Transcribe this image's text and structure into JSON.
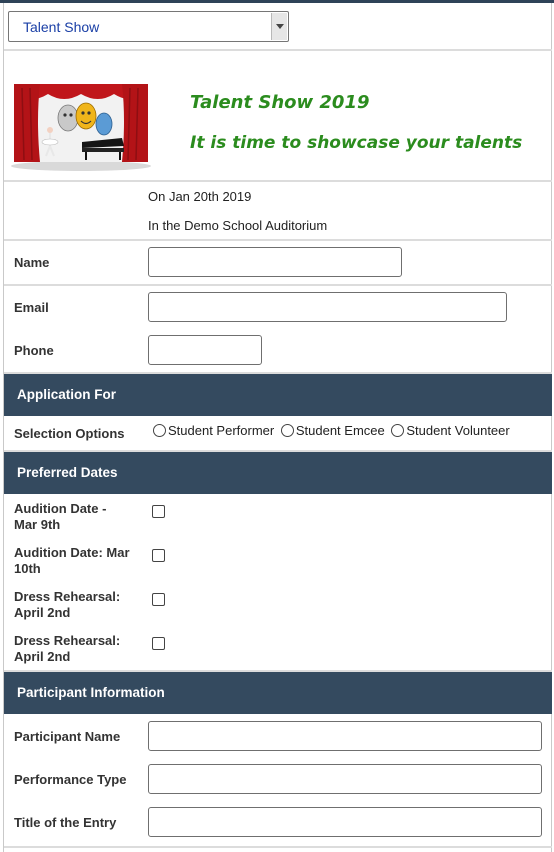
{
  "form_selector": {
    "value": "Talent Show"
  },
  "header": {
    "title": "Talent Show 2019",
    "tagline": "It is time to showcase your talents",
    "banner_icon": "theatre-stage-masks-piano-image"
  },
  "event": {
    "date": "On Jan 20th 2019",
    "location": "In the Demo School Auditorium"
  },
  "contact": {
    "name_label": "Name",
    "email_label": "Email",
    "phone_label": "Phone"
  },
  "application": {
    "section_title": "Application For",
    "options_label": "Selection Options",
    "options": [
      "Student Performer",
      "Student Emcee",
      "Student Volunteer"
    ]
  },
  "dates": {
    "section_title": "Preferred Dates",
    "items": [
      {
        "line1": "Audition Date -",
        "line2": "Mar 9th"
      },
      {
        "line1": "Audition Date: Mar",
        "line2": "10th"
      },
      {
        "line1": "Dress Rehearsal:",
        "line2": "April 2nd"
      },
      {
        "line1": "Dress Rehearsal:",
        "line2": "April 2nd"
      }
    ]
  },
  "participant": {
    "section_title": "Participant Information",
    "participant_name_label": "Participant Name",
    "performance_type_label": "Performance Type",
    "entry_title_label": "Title of the Entry"
  },
  "colors": {
    "section_bg": "#344a5f",
    "title_green": "#2b8c1e",
    "select_text": "#1a3fa6"
  }
}
